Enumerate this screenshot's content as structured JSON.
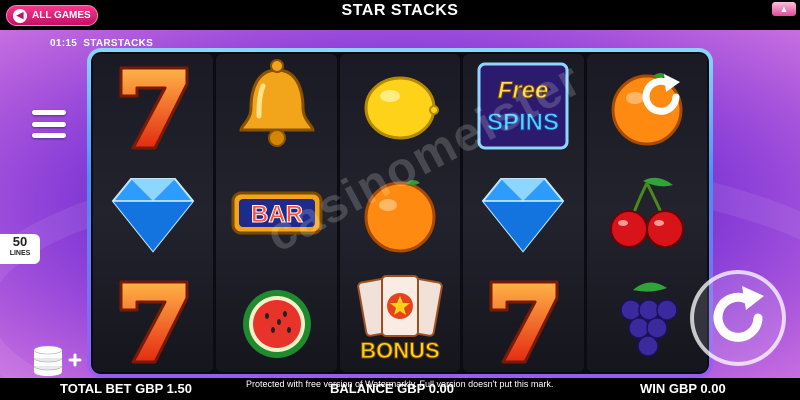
{
  "header": {
    "all_games_label": "ALL GAMES",
    "title": "STAR STACKS"
  },
  "info": {
    "clock": "01:15",
    "game_name": "STARSTACKS"
  },
  "left_panel": {
    "lines_count": "50",
    "lines_label": "LINES"
  },
  "reels": [
    [
      "seven",
      "diamond",
      "seven"
    ],
    [
      "bell",
      "bar",
      "watermelon"
    ],
    [
      "lemon",
      "orange",
      "bonus"
    ],
    [
      "free-spins",
      "diamond",
      "seven"
    ],
    [
      "orange",
      "cherries",
      "grapes"
    ]
  ],
  "symbol_text": {
    "bar": "BAR",
    "free": "Free",
    "spins": "SPINS",
    "bonus": "BONUS"
  },
  "footer": {
    "total_bet": "TOTAL BET GBP 1.50",
    "balance": "BALANCE GBP 0.00",
    "win": "WIN GBP 0.00",
    "watermark_note": "Protected with free version of Watermarkly. Full version doesn't put this mark."
  },
  "watermark": "casinomeister",
  "colors": {
    "accent_pink": "#e8237f",
    "frame_blue": "#4d8ef5",
    "background_purple": "#5a22b6"
  }
}
